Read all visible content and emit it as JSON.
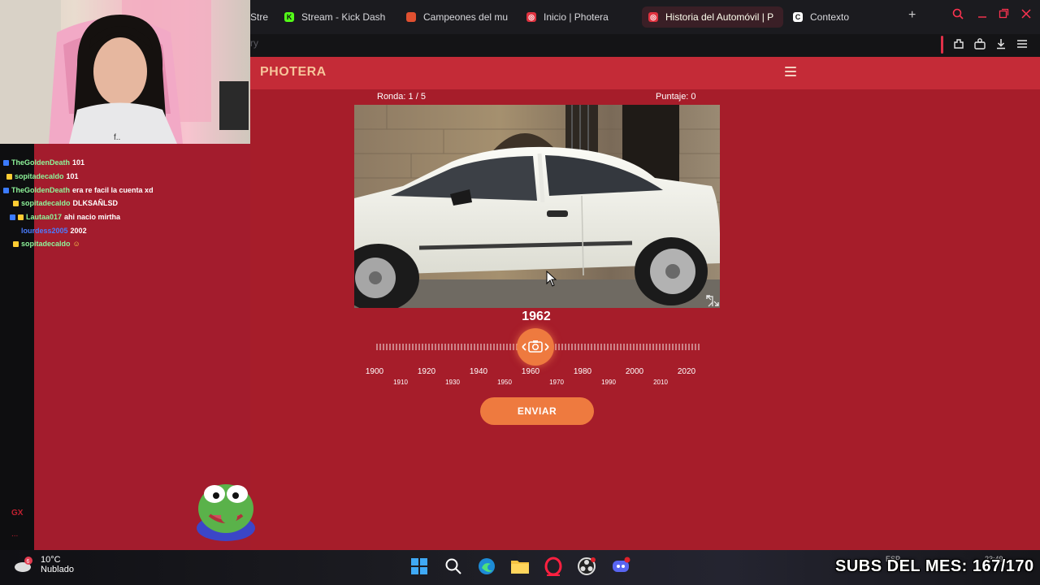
{
  "browser": {
    "tabs": [
      {
        "label": "Stre",
        "icon": "browser-tab-icon"
      },
      {
        "label": "Stream - Kick Dash",
        "icon": "kick-icon",
        "color": "#53fc18"
      },
      {
        "label": "Campeones del mu",
        "icon": "trophy-icon"
      },
      {
        "label": "Inicio | Photera",
        "icon": "photera-icon",
        "color": "#e0323f"
      },
      {
        "label": "Historia del Automóvil | P",
        "icon": "photera-icon",
        "color": "#e0323f",
        "active": true
      },
      {
        "label": "Contexto",
        "icon": "contexto-icon"
      }
    ],
    "new_tab": "+",
    "address_fragment": "ry"
  },
  "chat": {
    "messages": [
      {
        "user": "TheGoldenDeath",
        "text": "101"
      },
      {
        "user": "sopitadecaldo",
        "text": "101"
      },
      {
        "user": "TheGoldenDeath",
        "text": "era re facil la cuenta xd"
      },
      {
        "user": "sopitadecaldo",
        "text": "DLKSAÑLSD"
      },
      {
        "user": "Lautaa017",
        "text": "ahi nacio mirtha"
      },
      {
        "user": "lourdess2005",
        "text": "2002"
      },
      {
        "user": "sopitadecaldo",
        "text": ""
      }
    ],
    "gx_label": "GX",
    "more": "..."
  },
  "site": {
    "logo": "PHOTERA",
    "round_label": "Ronda: 1 / 5",
    "score_label": "Puntaje: 0",
    "selected_year": "1962",
    "slider": {
      "min": 1900,
      "max": 2025,
      "value": 1962
    },
    "ticks_major": [
      "1900",
      "1920",
      "1940",
      "1960",
      "1980",
      "2000",
      "2020"
    ],
    "ticks_minor": [
      "1910",
      "1930",
      "1950",
      "1970",
      "1990",
      "2010"
    ],
    "submit_label": "ENVIAR",
    "accent": "#ee7a3f",
    "background": "#a61d2a"
  },
  "taskbar": {
    "weather_temp": "10°C",
    "weather_cond": "Nublado",
    "weather_badge": "6",
    "lang": "ESP",
    "time": "23:49",
    "subs_banner": "SUBS DEL MES: 167/170"
  }
}
